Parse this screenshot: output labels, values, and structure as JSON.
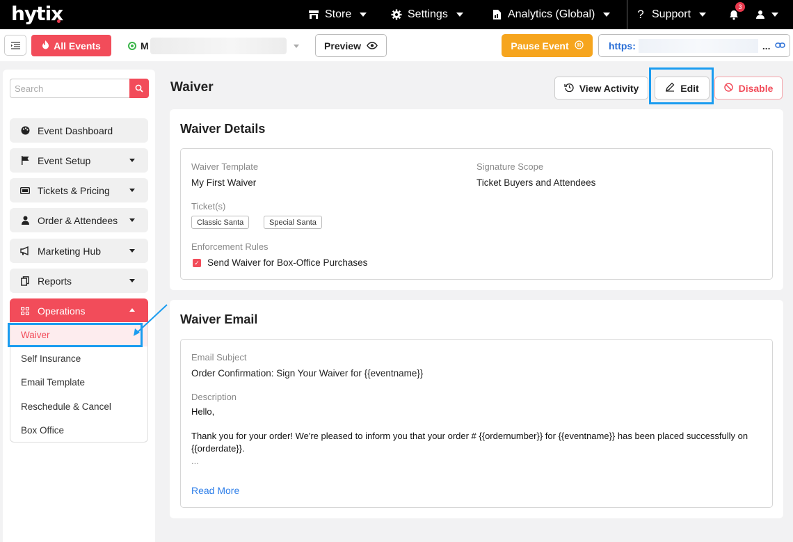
{
  "topnav": {
    "logo": "hytix",
    "store": "Store",
    "settings": "Settings",
    "analytics": "Analytics (Global)",
    "support": "Support",
    "notification_count": "3"
  },
  "subbar": {
    "all_events": "All Events",
    "event_name_visible": "M",
    "preview": "Preview",
    "pause_event": "Pause Event",
    "url_prefix": "https:",
    "url_suffix": "..."
  },
  "sidebar": {
    "search_placeholder": "Search",
    "items": [
      {
        "label": "Event Dashboard",
        "icon": "palette-icon"
      },
      {
        "label": "Event Setup",
        "icon": "flag-icon"
      },
      {
        "label": "Tickets & Pricing",
        "icon": "ticket-icon"
      },
      {
        "label": "Order & Attendees",
        "icon": "user-icon"
      },
      {
        "label": "Marketing Hub",
        "icon": "megaphone-icon"
      },
      {
        "label": "Reports",
        "icon": "copy-icon"
      },
      {
        "label": "Operations",
        "icon": "grid-icon"
      }
    ],
    "submenu": [
      "Waiver",
      "Self Insurance",
      "Email Template",
      "Reschedule & Cancel",
      "Box Office"
    ]
  },
  "main": {
    "title": "Waiver",
    "view_activity": "View Activity",
    "edit": "Edit",
    "disable": "Disable",
    "details": {
      "title": "Waiver Details",
      "template_label": "Waiver Template",
      "template_value": "My First Waiver",
      "scope_label": "Signature Scope",
      "scope_value": "Ticket Buyers and Attendees",
      "tickets_label": "Ticket(s)",
      "tickets": [
        "Classic Santa",
        "Special Santa"
      ],
      "rules_label": "Enforcement Rules",
      "rule_1": "Send Waiver for Box-Office Purchases"
    },
    "email": {
      "title": "Waiver Email",
      "subject_label": "Email Subject",
      "subject_value": "Order Confirmation: Sign Your Waiver for {{eventname}}",
      "description_label": "Description",
      "desc_line1": "Hello,",
      "desc_line2": "Thank you for your order! We're pleased to inform you that your order # {{ordernumber}} for {{eventname}} has been placed successfully on",
      "desc_line3": "{{orderdate}}.",
      "desc_line4": "...",
      "read_more": "Read More"
    }
  },
  "colors": {
    "brand_red": "#f24c5a",
    "pause_orange": "#f6a51e",
    "highlight_blue": "#1a9cf0",
    "link_blue": "#2b7de9"
  }
}
